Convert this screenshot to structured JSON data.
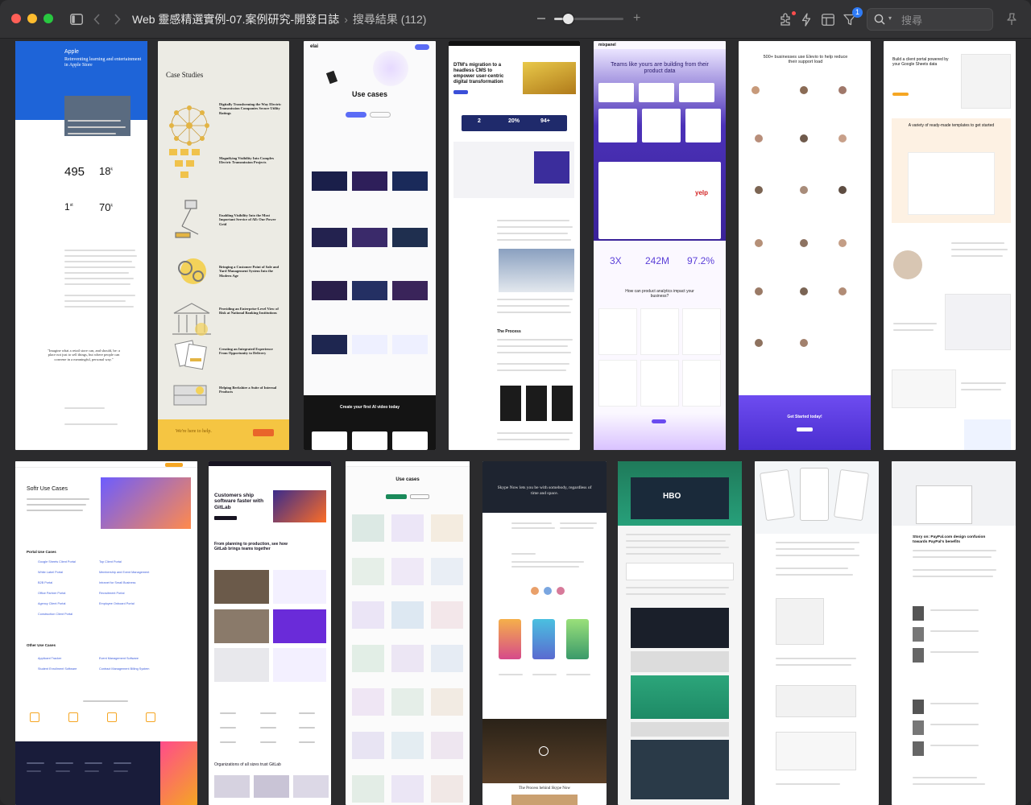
{
  "window": {
    "title": "Web 靈感精選實例-07.案例研究-開發日誌",
    "result_label": "搜尋結果 (112)"
  },
  "toolbar": {
    "search_placeholder": "搜尋",
    "notification_count": "1",
    "zoom_level": 0.2
  },
  "icons": [
    "sidebar-icon",
    "back-icon",
    "forward-icon",
    "extensions-icon",
    "lightning-icon",
    "layout-icon",
    "filter-icon",
    "search-icon",
    "pin-icon"
  ],
  "colors": {
    "accent": "#2f7bf6",
    "chrome": "#323234"
  },
  "thumbnails": {
    "apple": {
      "brand": "Apple",
      "headline": "Reinventing learning and entertainment in Apple Store",
      "stats": [
        "495",
        "18",
        "1",
        "70"
      ],
      "stat_sups": [
        "",
        "k",
        "st",
        "k"
      ],
      "quote": "\"Imagine what a retail store can, and should, be: a place not just to sell things, but where people can convene in a meaningful, personal way.\""
    },
    "casestudies": {
      "title": "Case Studies",
      "items": [
        "Digitally Transforming the Way Electric Transmission Companies Secure Utility Ratings",
        "Magnifying Visibility Into Complex Electric Transmission Projects",
        "Enabling Visibility Into the Most Important Service of All: Our Power Grid",
        "Bringing a Customer Point of Sale and Yard Management System Into the Modern Age",
        "Providing an Enterprise-Level View of Risk at National Banking Institutions",
        "Creating an Integrated Experience From Opportunity to Delivery",
        "Helping Berkshire a Suite of Internal Products"
      ],
      "footer": "We're here to help."
    },
    "elai": {
      "logo": "elai",
      "title": "Use cases",
      "footer": "Create your first AI video today"
    },
    "dtm": {
      "title": "DTM's migration to a headless CMS to empower user-centric digital transformation",
      "stats": [
        "2",
        "20%",
        "94+"
      ],
      "section": "The Process"
    },
    "mixpanel": {
      "logo": "mixpanel",
      "title": "Teams like yours are building from their product data",
      "stats": [
        "3X",
        "242M",
        "97.2%"
      ],
      "question": "How can product analytics impact your business?",
      "brand": "yelp"
    },
    "elevio": {
      "title": "500+ businesses use Elevio to help reduce their support load",
      "footer": "Get Started today!"
    },
    "softr_right": {
      "title": "Build a client portal powered by your Google Sheets data",
      "subtitle": "A variety of ready-made templates to get started"
    },
    "softr_left": {
      "title": "Softr Use Cases",
      "portal_heading": "Portal Use Cases",
      "portal_links": [
        "Google Sheets Client Portal",
        "Top Client Portal",
        "White Label Portal",
        "Membership and Event Management",
        "B2B Portal",
        "Intranet for Small Business",
        "Office Partner Portal",
        "Recruitment Portal",
        "Agency Client Portal",
        "Employee Onboard Portal",
        "Construction Client Portal"
      ],
      "other_heading": "Other Use Cases",
      "other_links": [
        "Applicant Tracker",
        "Event Management Software",
        "Student Enrollment Software",
        "Contract Management Billing System"
      ]
    },
    "gitlab": {
      "title": "Customers ship software faster with GitLab",
      "subtitle": "From planning to production, see how GitLab brings teams together",
      "footer": "Organizations of all sizes trust GitLab"
    },
    "usecases": {
      "title": "Use cases"
    },
    "skype": {
      "title": "Skype Now lets you be with somebody, regardless of time and space.",
      "footer": "The Process behind Skype Now"
    },
    "hbo": {
      "logo": "HBO"
    },
    "paypal": {
      "title": "Story on: PayPal.com design confusion towards PayPal's benefits"
    }
  }
}
